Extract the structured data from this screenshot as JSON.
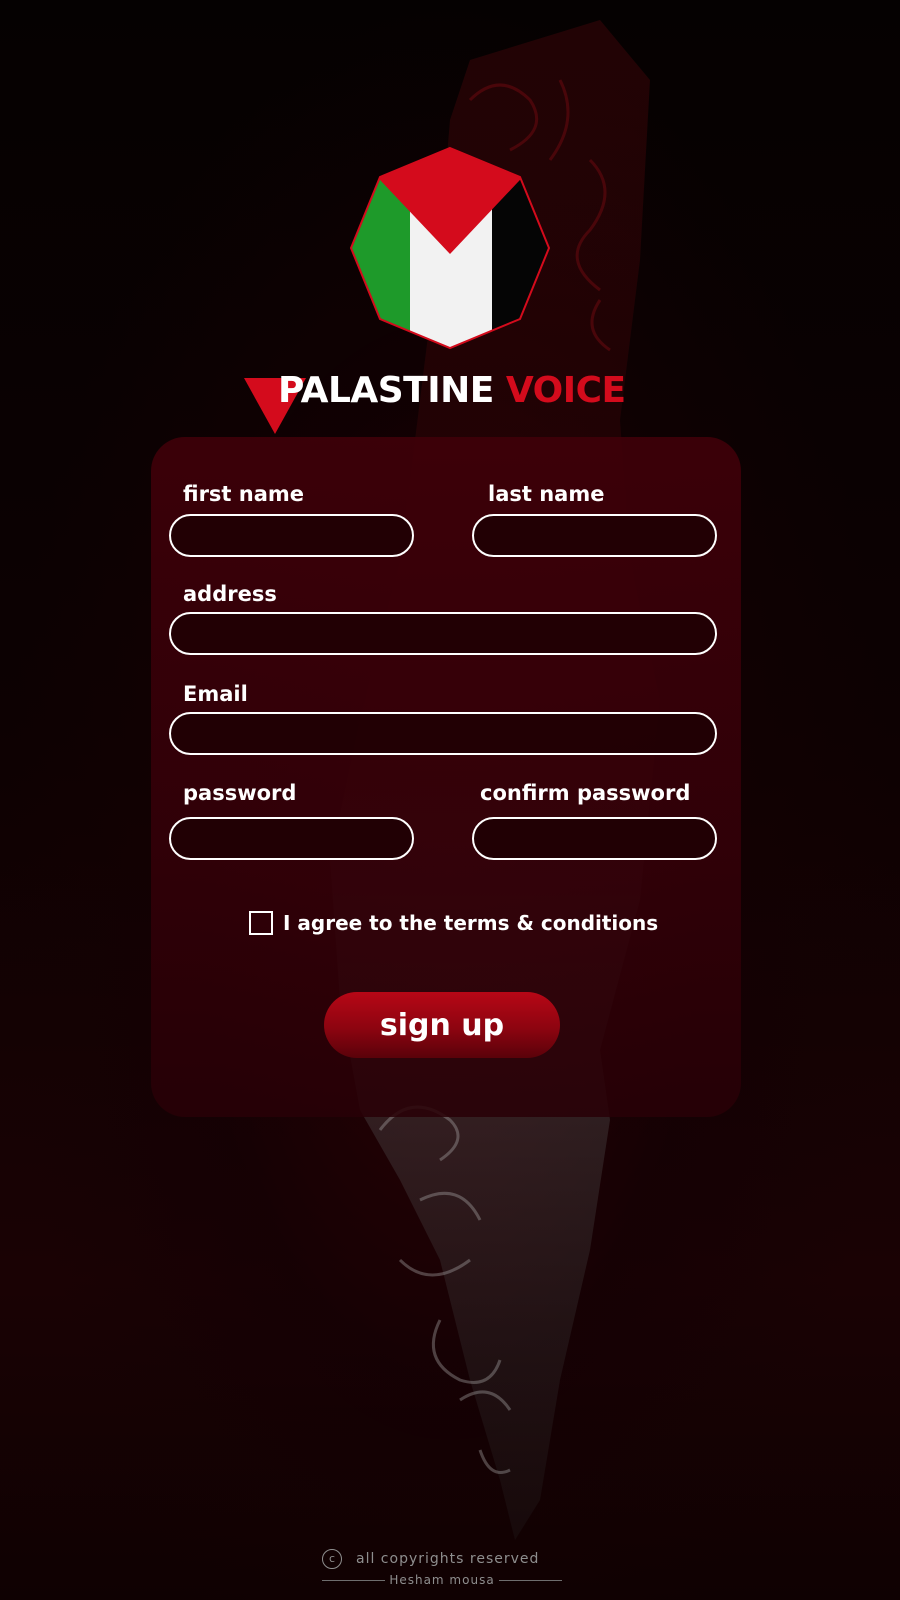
{
  "brand": {
    "name_part1": "PALASTINE",
    "name_part2": "VOICE",
    "logo_icon": "palestine-flag-octagon-icon",
    "colors": {
      "red": "#d40b1c",
      "green": "#1e9a2a",
      "white": "#f2f2f2",
      "black": "#000000"
    }
  },
  "form": {
    "first_name": {
      "label": "first name",
      "value": "",
      "placeholder": ""
    },
    "last_name": {
      "label": "last name",
      "value": "",
      "placeholder": ""
    },
    "address": {
      "label": "address",
      "value": "",
      "placeholder": ""
    },
    "email": {
      "label": "Email",
      "value": "",
      "placeholder": ""
    },
    "password": {
      "label": "password",
      "value": "",
      "placeholder": ""
    },
    "confirm_password": {
      "label": "confirm password",
      "value": "",
      "placeholder": ""
    },
    "terms": {
      "label": "I agree to the terms & conditions",
      "checked": false
    },
    "submit_label": "sign up"
  },
  "footer": {
    "copyright_icon": "copyright-icon",
    "copyright_symbol": "c",
    "copyright_text": "all copyrights reserved",
    "author": "Hesham mousa"
  }
}
